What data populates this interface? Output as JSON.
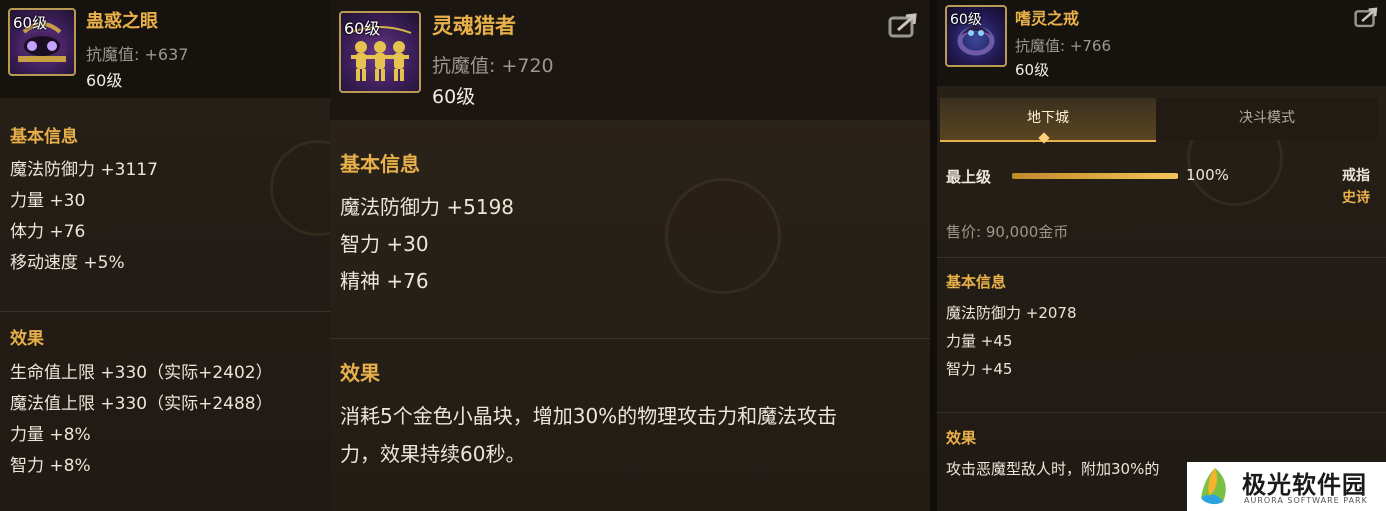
{
  "panel1": {
    "level_badge": "60级",
    "item_name": "蛊惑之眼",
    "resist": "抗魔值: +637",
    "level": "60级",
    "basic_title": "基本信息",
    "basic": [
      "魔法防御力 +3117",
      "力量 +30",
      "体力 +76",
      "移动速度 +5%"
    ],
    "effect_title": "效果",
    "effects": [
      "生命值上限 +330（实际+2402）",
      "魔法值上限 +330（实际+2488）",
      "力量 +8%",
      "智力 +8%"
    ]
  },
  "panel2": {
    "level_badge": "60级",
    "item_name": "灵魂猎者",
    "resist": "抗魔值: +720",
    "level": "60级",
    "basic_title": "基本信息",
    "basic": [
      "魔法防御力 +5198",
      "智力 +30",
      "精神 +76"
    ],
    "effect_title": "效果",
    "effect_lines": [
      "消耗5个金色小晶块，增加30%的物理攻击力和魔法攻击",
      "力，效果持续60秒。"
    ]
  },
  "panel3": {
    "level_badge": "60级",
    "item_name": "嗜灵之戒",
    "resist": "抗魔值: +766",
    "level": "60级",
    "tabs": [
      "地下城",
      "决斗模式"
    ],
    "grade_label": "最上级",
    "grade_percent": "100%",
    "grade_fill": 1.0,
    "slot": "戒指",
    "rarity": "史诗",
    "price": "售价: 90,000金币",
    "basic_title": "基本信息",
    "basic": [
      "魔法防御力 +2078",
      "力量 +45",
      "智力 +45"
    ],
    "effect_title": "效果",
    "effect_line": "攻击恶魔型敌人时，附加30%的"
  },
  "watermark": {
    "cn": "极光软件园",
    "en": "AURORA SOFTWARE PARK"
  },
  "colors": {
    "accent_gold": "#e8b04a",
    "background": "#231d16",
    "text": "#ece6d8"
  },
  "icons": [
    "share-icon",
    "item-icon"
  ]
}
